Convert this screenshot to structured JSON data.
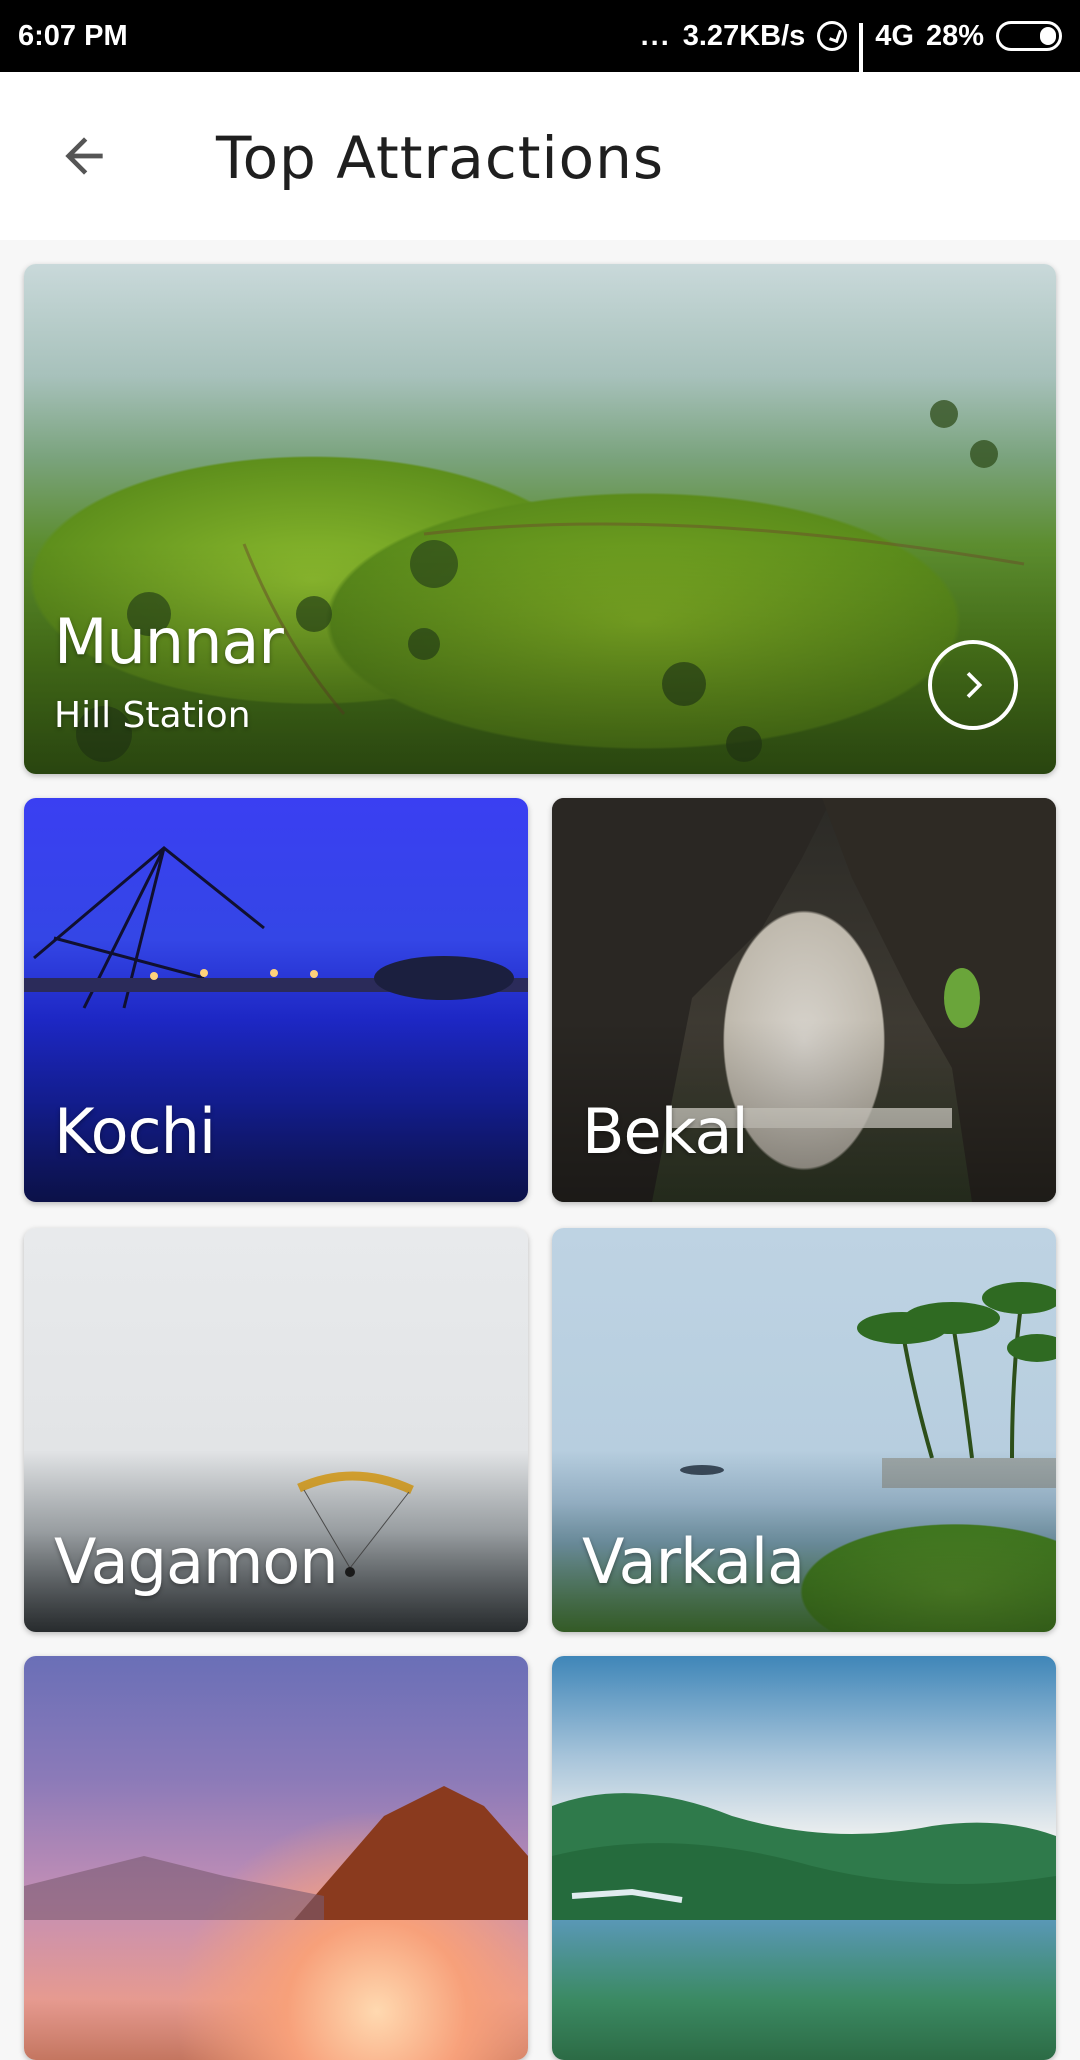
{
  "status_bar": {
    "time": "6:07 PM",
    "dots": "...",
    "network_speed": "3.27KB/s",
    "network_type": "4G",
    "battery": "28%"
  },
  "app_bar": {
    "title": "Top Attractions",
    "back_icon": "arrow-left-icon"
  },
  "attractions": [
    {
      "name": "Munnar",
      "subtitle": "Hill Station",
      "action_icon": "chevron-right-circle-icon"
    },
    {
      "name": "Kochi"
    },
    {
      "name": "Bekal"
    },
    {
      "name": "Vagamon"
    },
    {
      "name": "Varkala"
    },
    {
      "name": ""
    },
    {
      "name": ""
    }
  ]
}
